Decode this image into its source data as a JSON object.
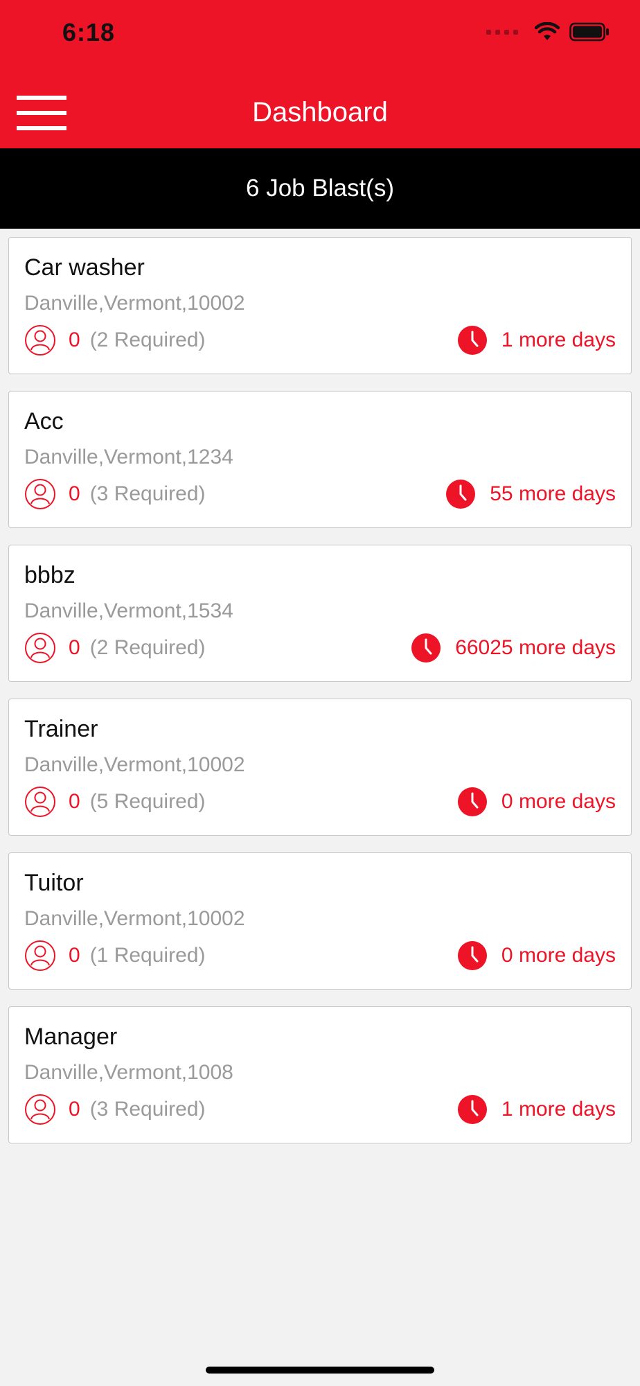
{
  "status_bar": {
    "time": "6:18"
  },
  "nav": {
    "title": "Dashboard"
  },
  "summary": {
    "label": "6 Job Blast(s)"
  },
  "jobs": [
    {
      "title": "Car washer",
      "location": "Danville,Vermont,10002",
      "applied": "0",
      "required": "(2 Required)",
      "days": "1 more days"
    },
    {
      "title": "Acc",
      "location": "Danville,Vermont,1234",
      "applied": "0",
      "required": "(3 Required)",
      "days": "55 more days"
    },
    {
      "title": "bbbz",
      "location": "Danville,Vermont,1534",
      "applied": "0",
      "required": "(2 Required)",
      "days": "66025 more days"
    },
    {
      "title": "Trainer",
      "location": "Danville,Vermont,10002",
      "applied": "0",
      "required": "(5 Required)",
      "days": "0 more days"
    },
    {
      "title": "Tuitor",
      "location": "Danville,Vermont,10002",
      "applied": "0",
      "required": "(1 Required)",
      "days": "0 more days"
    },
    {
      "title": "Manager",
      "location": "Danville,Vermont,1008",
      "applied": "0",
      "required": "(3 Required)",
      "days": "1 more days"
    }
  ],
  "icons": {
    "menu": "hamburger-menu-icon",
    "applicants": "person-icon",
    "deadline": "clock-icon",
    "wifi": "wifi-icon",
    "battery": "battery-icon",
    "signal": "cellular-signal-icon"
  },
  "colors": {
    "brand": "#ee1428",
    "header_bar": "#000000",
    "background": "#f2f2f2",
    "muted_text": "#9a9a9a"
  }
}
